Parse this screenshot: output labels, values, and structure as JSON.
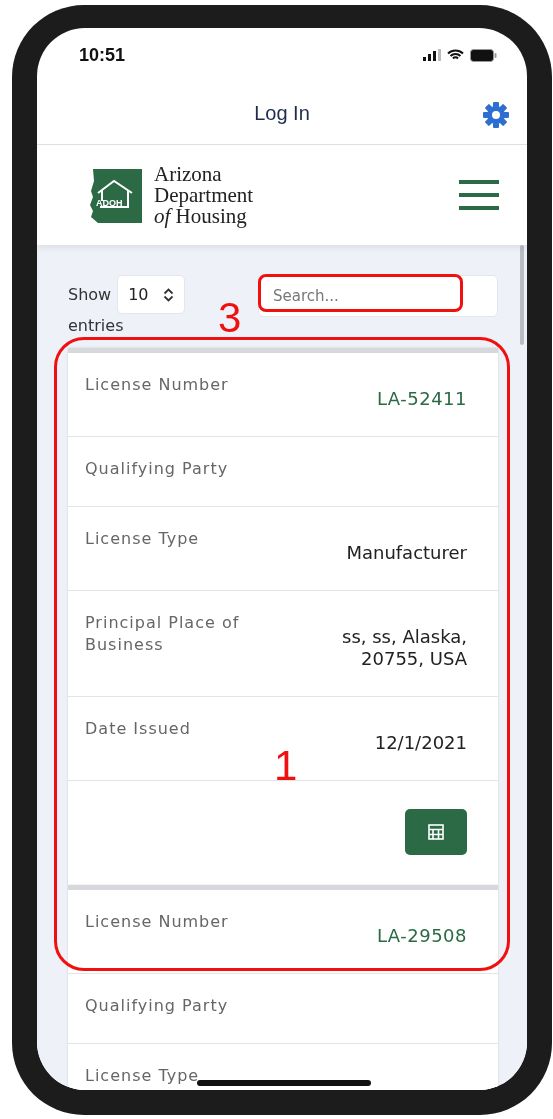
{
  "status_bar": {
    "time": "10:51"
  },
  "header": {
    "title": "Log In"
  },
  "logo": {
    "badge": "ADOH",
    "lines": [
      "Arizona",
      "Department",
      "*of* Housing"
    ]
  },
  "entries_control": {
    "before": "Show",
    "value": "10",
    "after": "entries"
  },
  "search": {
    "placeholder": "Search..."
  },
  "records": [
    {
      "fields": [
        {
          "label": "License Number",
          "value": "LA-52411",
          "kind": "link"
        },
        {
          "label": "Qualifying Party"
        },
        {
          "label": "License Type",
          "value": "Manufacturer",
          "kind": "text"
        },
        {
          "label": "Principal Place of Business",
          "value": "ss, ss, Alaska, 20755, USA",
          "kind": "text"
        },
        {
          "label": "Date Issued",
          "value": "12/1/2021",
          "kind": "text"
        }
      ],
      "action": true
    },
    {
      "fields": [
        {
          "label": "License Number",
          "value": "LA-29508",
          "kind": "link"
        },
        {
          "label": "Qualifying Party"
        },
        {
          "label": "License Type"
        }
      ]
    }
  ],
  "annotations": [
    {
      "label": "3",
      "kind": "search-highlight"
    },
    {
      "label": "1",
      "kind": "records-highlight"
    }
  ]
}
